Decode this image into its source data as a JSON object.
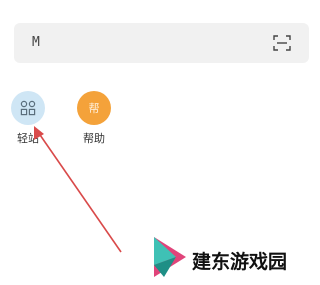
{
  "search": {
    "text": "M"
  },
  "shortcuts": [
    {
      "label": "轻站",
      "icon": "grid-icon"
    },
    {
      "label": "帮助",
      "icon": "help-icon",
      "icon_text": "帮"
    }
  ],
  "annotation": {
    "arrow_color": "#d94a4a"
  },
  "watermark": {
    "text": "建东游戏园"
  },
  "colors": {
    "search_bg": "#f1f1f1",
    "qingzhan_circle": "#cfe6f5",
    "bangzhu_circle": "#f4a23a"
  }
}
